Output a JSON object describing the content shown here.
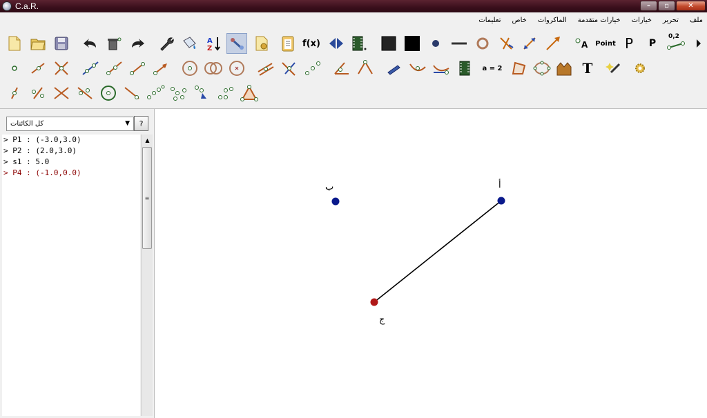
{
  "window": {
    "title": "C.a.R.",
    "minimize": "–",
    "maximize": "▫",
    "close": "✕"
  },
  "menu": [
    "ملف",
    "تحرير",
    "خيارات",
    "خيارات متقدمة",
    "الماكروات",
    "خاص",
    "تعليمات"
  ],
  "toolbar_text": {
    "fx": "f(x)",
    "point": "Point",
    "p_big": "P",
    "p_small": "P",
    "coord": "0,2",
    "a_eq_2": "a = 2",
    "text_tool": "T",
    "label_a": "A"
  },
  "panel": {
    "filter_value": "كل الكائنات",
    "help": "?",
    "objects": [
      {
        "text": "> P1 : (-3.0,3.0)",
        "color": "#000000"
      },
      {
        "text": "> P2 : (2.0,3.0)",
        "color": "#000000"
      },
      {
        "text": "> s1 : 5.0",
        "color": "#000000"
      },
      {
        "text": "> P4 : (-1.0,0.0)",
        "color": "#8b0000"
      }
    ]
  },
  "canvas": {
    "labels": {
      "p1": "أ",
      "p2": "ب",
      "p4": "ج"
    },
    "colors": {
      "point": "#0a1a8c",
      "selected_point": "#b01818",
      "segment": "#000000"
    }
  }
}
